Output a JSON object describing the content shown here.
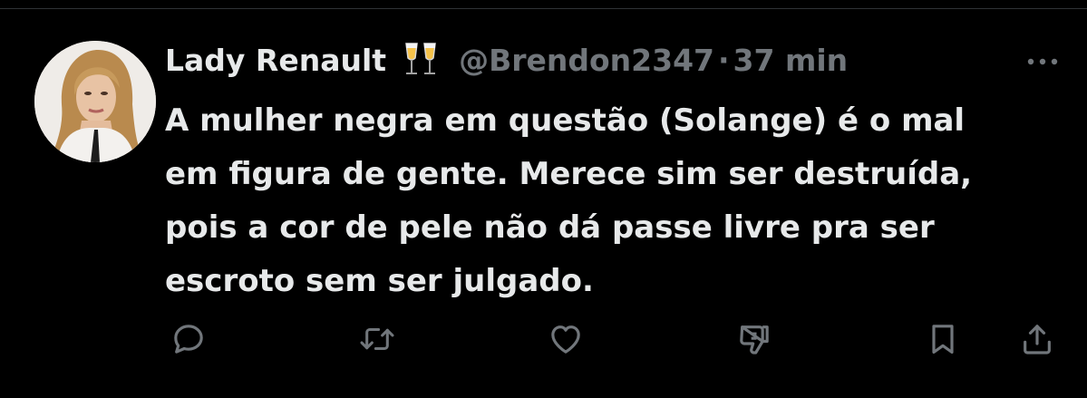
{
  "tweet": {
    "display_name": "Lady Renault",
    "name_emoji": "clinking-glasses-emoji",
    "handle": "@Brendon2347",
    "separator": "·",
    "timestamp": "37 min",
    "text_lines": [
      "A mulher negra em questão (Solange) é o mal",
      "em figura de gente. Merece sim ser destruída,",
      "pois a cor de pele não dá passe livre pra ser",
      "escroto sem ser julgado."
    ]
  },
  "icons": {
    "more": "more-horizontal-icon",
    "reply": "reply-icon",
    "retweet": "retweet-icon",
    "like": "heart-icon",
    "dislike": "thumbs-down-icon",
    "bookmark": "bookmark-icon",
    "share": "share-icon"
  },
  "colors": {
    "background": "#000000",
    "primary_text": "#e7e9ea",
    "secondary_text": "#71767b",
    "divider": "#2f3336"
  }
}
